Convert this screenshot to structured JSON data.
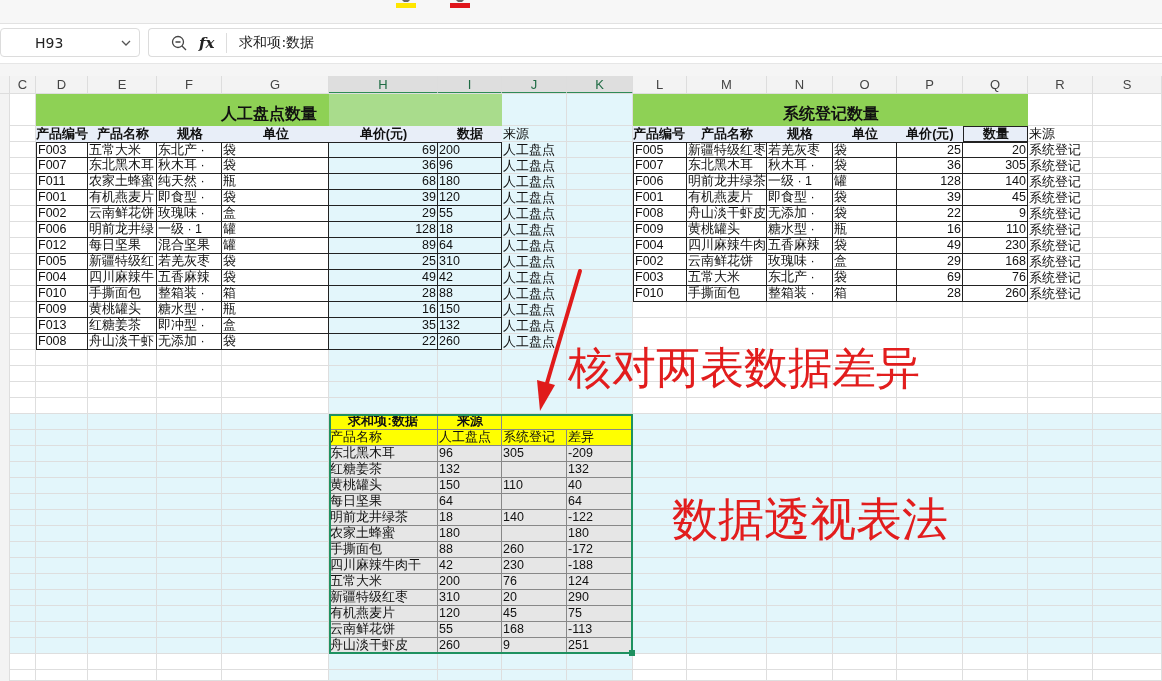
{
  "formula_bar": {
    "name_box": "H93",
    "function_label": "fx",
    "formula": "求和项:数据"
  },
  "columns": [
    {
      "label": "C",
      "selected": false
    },
    {
      "label": "D",
      "selected": false
    },
    {
      "label": "E",
      "selected": false
    },
    {
      "label": "F",
      "selected": false
    },
    {
      "label": "G",
      "selected": false
    },
    {
      "label": "H",
      "selected": true
    },
    {
      "label": "I",
      "selected": true
    },
    {
      "label": "J",
      "selected": true
    },
    {
      "label": "K",
      "selected": true
    },
    {
      "label": "L",
      "selected": false
    },
    {
      "label": "M",
      "selected": false
    },
    {
      "label": "N",
      "selected": false
    },
    {
      "label": "O",
      "selected": false
    },
    {
      "label": "P",
      "selected": false
    },
    {
      "label": "Q",
      "selected": false
    },
    {
      "label": "R",
      "selected": false
    },
    {
      "label": "S",
      "selected": false
    }
  ],
  "manual_table": {
    "title": "人工盘点数量",
    "headers": [
      "产品编号",
      "产品名称",
      "规格",
      "单位",
      "单价(元)",
      "数据"
    ],
    "source_header": "来源",
    "rows": [
      {
        "cells": [
          "F003",
          "五常大米",
          "东北产 ·",
          "袋",
          "69",
          "200"
        ],
        "source": "人工盘点"
      },
      {
        "cells": [
          "F007",
          "东北黑木耳",
          "秋木耳 ·",
          "袋",
          "36",
          "96"
        ],
        "source": "人工盘点"
      },
      {
        "cells": [
          "F011",
          "农家土蜂蜜",
          "纯天然 ·",
          "瓶",
          "68",
          "180"
        ],
        "source": "人工盘点"
      },
      {
        "cells": [
          "F001",
          "有机燕麦片",
          "即食型 ·",
          "袋",
          "39",
          "120"
        ],
        "source": "人工盘点"
      },
      {
        "cells": [
          "F002",
          "云南鲜花饼",
          "玫瑰味 ·",
          "盒",
          "29",
          "55"
        ],
        "source": "人工盘点"
      },
      {
        "cells": [
          "F006",
          "明前龙井绿",
          "一级 · 1",
          "罐",
          "128",
          "18"
        ],
        "source": "人工盘点"
      },
      {
        "cells": [
          "F012",
          "每日坚果",
          "混合坚果",
          "罐",
          "89",
          "64"
        ],
        "source": "人工盘点"
      },
      {
        "cells": [
          "F005",
          "新疆特级红",
          "若羌灰枣",
          "袋",
          "25",
          "310"
        ],
        "source": "人工盘点"
      },
      {
        "cells": [
          "F004",
          "四川麻辣牛",
          "五香麻辣",
          "袋",
          "49",
          "42"
        ],
        "source": "人工盘点"
      },
      {
        "cells": [
          "F010",
          "手撕面包",
          "整箱装 ·",
          "箱",
          "28",
          "88"
        ],
        "source": "人工盘点"
      },
      {
        "cells": [
          "F009",
          "黄桃罐头",
          "糖水型 ·",
          "瓶",
          "16",
          "150"
        ],
        "source": "人工盘点"
      },
      {
        "cells": [
          "F013",
          "红糖姜茶",
          "即冲型 ·",
          "盒",
          "35",
          "132"
        ],
        "source": "人工盘点"
      },
      {
        "cells": [
          "F008",
          "舟山淡干虾",
          "无添加 ·",
          "袋",
          "22",
          "260"
        ],
        "source": "人工盘点"
      }
    ]
  },
  "system_table": {
    "title": "系统登记数量",
    "headers": [
      "产品编号",
      "产品名称",
      "规格",
      "单位",
      "单价(元)",
      "数量"
    ],
    "source_header": "来源",
    "rows": [
      {
        "cells": [
          "F005",
          "新疆特级红枣",
          "若羌灰枣",
          "袋",
          "25",
          "20"
        ],
        "source": "系统登记"
      },
      {
        "cells": [
          "F007",
          "东北黑木耳",
          "秋木耳 ·",
          "袋",
          "36",
          "305"
        ],
        "source": "系统登记"
      },
      {
        "cells": [
          "F006",
          "明前龙井绿茶",
          "一级 · 1",
          "罐",
          "128",
          "140"
        ],
        "source": "系统登记"
      },
      {
        "cells": [
          "F001",
          "有机燕麦片",
          "即食型 ·",
          "袋",
          "39",
          "45"
        ],
        "source": "系统登记"
      },
      {
        "cells": [
          "F008",
          "舟山淡干虾皮",
          "无添加 ·",
          "袋",
          "22",
          "9"
        ],
        "source": "系统登记"
      },
      {
        "cells": [
          "F009",
          "黄桃罐头",
          "糖水型 ·",
          "瓶",
          "16",
          "110"
        ],
        "source": "系统登记"
      },
      {
        "cells": [
          "F004",
          "四川麻辣牛肉",
          "五香麻辣",
          "袋",
          "49",
          "230"
        ],
        "source": "系统登记"
      },
      {
        "cells": [
          "F002",
          "云南鲜花饼",
          "玫瑰味 ·",
          "盒",
          "29",
          "168"
        ],
        "source": "系统登记"
      },
      {
        "cells": [
          "F003",
          "五常大米",
          "东北产 ·",
          "袋",
          "69",
          "76"
        ],
        "source": "系统登记"
      },
      {
        "cells": [
          "F010",
          "手撕面包",
          "整箱装 ·",
          "箱",
          "28",
          "260"
        ],
        "source": "系统登记"
      }
    ]
  },
  "pivot": {
    "selected": true,
    "value_label": "求和项:数据",
    "column_label": "来源",
    "headers": [
      "产品名称",
      "人工盘点",
      "系统登记",
      "差异"
    ],
    "rows": [
      [
        "东北黑木耳",
        "96",
        "305",
        "-209"
      ],
      [
        "红糖姜茶",
        "132",
        null,
        "132"
      ],
      [
        "黄桃罐头",
        "150",
        "110",
        "40"
      ],
      [
        "每日坚果",
        "64",
        null,
        "64"
      ],
      [
        "明前龙井绿茶",
        "18",
        "140",
        "-122"
      ],
      [
        "农家土蜂蜜",
        "180",
        null,
        "180"
      ],
      [
        "手撕面包",
        "88",
        "260",
        "-172"
      ],
      [
        "四川麻辣牛肉干",
        "42",
        "230",
        "-188"
      ],
      [
        "五常大米",
        "200",
        "76",
        "124"
      ],
      [
        "新疆特级红枣",
        "310",
        "20",
        "290"
      ],
      [
        "有机燕麦片",
        "120",
        "45",
        "75"
      ],
      [
        "云南鲜花饼",
        "55",
        "168",
        "-113"
      ],
      [
        "舟山淡干虾皮",
        "260",
        "9",
        "251"
      ]
    ]
  },
  "annotations": [
    "核对两表数据差异",
    "数据透视表法"
  ]
}
